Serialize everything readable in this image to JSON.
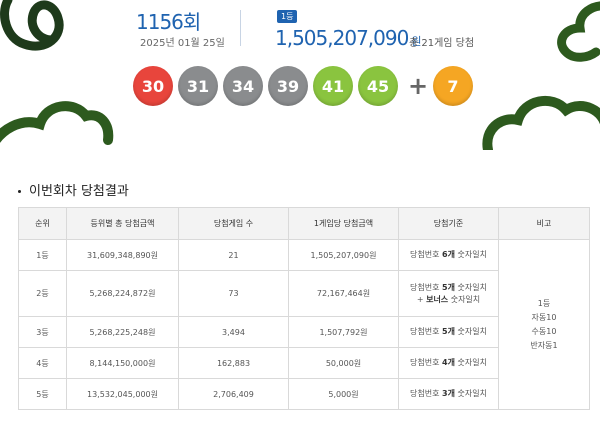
{
  "header": {
    "round": "1156회",
    "date": "2025년 01월 25일",
    "rank_badge": "1등",
    "first_prize": "1,505,207,090",
    "won": "원",
    "total_games": "총 21게임 당첨"
  },
  "numbers": [
    {
      "value": "30",
      "color": "#e8453c"
    },
    {
      "value": "31",
      "color": "#8a8c8e"
    },
    {
      "value": "34",
      "color": "#8a8c8e"
    },
    {
      "value": "39",
      "color": "#8a8c8e"
    },
    {
      "value": "41",
      "color": "#8ac43f"
    },
    {
      "value": "45",
      "color": "#8ac43f"
    }
  ],
  "plus": "+",
  "bonus": {
    "value": "7",
    "color": "#f5a623"
  },
  "section_title": "이번회차 당첨결과",
  "table": {
    "headers": [
      "순위",
      "등위별 총 당첨금액",
      "당첨게임 수",
      "1게임당 당첨금액",
      "당첨기준",
      "비고"
    ],
    "rows": [
      {
        "rank": "1등",
        "total": "31,609,348,890원",
        "games": "21",
        "per_game": "1,505,207,090원",
        "crit_a": "당첨번호 ",
        "crit_b": "6개",
        "crit_c": " 숫자일치"
      },
      {
        "rank": "2등",
        "total": "5,268,224,872원",
        "games": "73",
        "per_game": "72,167,464원",
        "crit_a": "당첨번호 ",
        "crit_b": "5개",
        "crit_c": " 숫자일치",
        "crit2_a": "+ ",
        "crit2_b": "보너스",
        "crit2_c": " 숫자일치"
      },
      {
        "rank": "3등",
        "total": "5,268,225,248원",
        "games": "3,494",
        "per_game": "1,507,792원",
        "crit_a": "당첨번호 ",
        "crit_b": "5개",
        "crit_c": " 숫자일치"
      },
      {
        "rank": "4등",
        "total": "8,144,150,000원",
        "games": "162,883",
        "per_game": "50,000원",
        "crit_a": "당첨번호 ",
        "crit_b": "4개",
        "crit_c": " 숫자일치"
      },
      {
        "rank": "5등",
        "total": "13,532,045,000원",
        "games": "2,706,409",
        "per_game": "5,000원",
        "crit_a": "당첨번호 ",
        "crit_b": "3개",
        "crit_c": " 숫자일치"
      }
    ],
    "remarks": [
      "1등",
      "자동10",
      "수동10",
      "반자동1"
    ]
  },
  "colors": {
    "accent": "#1f63b0",
    "deco_green": "#2d5a1e"
  }
}
